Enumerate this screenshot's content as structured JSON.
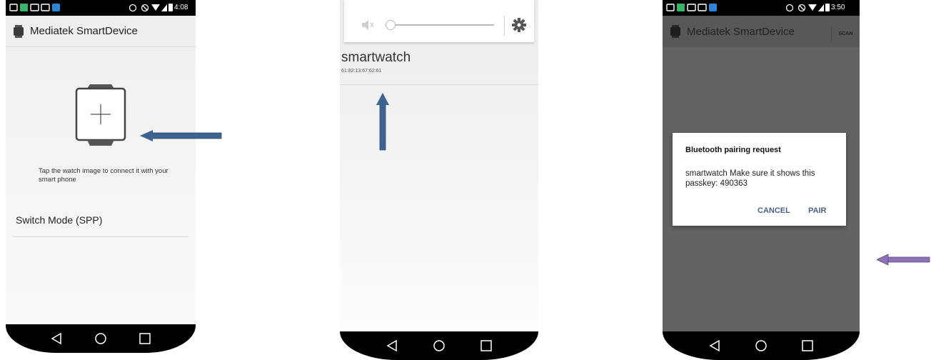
{
  "screen1": {
    "statusbar_time": "4:08",
    "app_title": "Mediatek SmartDevice",
    "hint": "Tap the watch image to connect it with your smart phone",
    "switch_mode": "Switch Mode (SPP)"
  },
  "screen2": {
    "device_name": "smartwatch",
    "device_mac": "61:82:13:67:62:61"
  },
  "screen3": {
    "statusbar_time": "3:50",
    "app_title": "Mediatek SmartDevice",
    "scan_label": "SCAN",
    "dialog": {
      "title": "Bluetooth pairing request",
      "message": "smartwatch Make sure it shows this passkey: 490363",
      "cancel": "CANCEL",
      "pair": "PAIR"
    }
  },
  "colors": {
    "arrow_blue": "#3f6390",
    "arrow_purple": "#8e70b8",
    "dialog_button": "#4a6383"
  },
  "icons": [
    "back-icon",
    "home-icon",
    "recents-icon",
    "gear-icon",
    "volume-mute-icon",
    "watch-add-icon",
    "smartwatch-app-icon"
  ]
}
